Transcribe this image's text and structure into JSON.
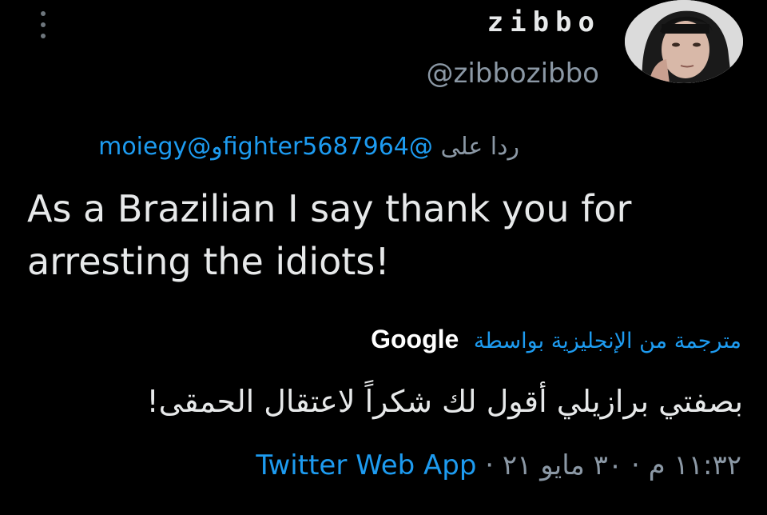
{
  "user": {
    "display_name": "zibbo",
    "handle": "@zibbozibbo"
  },
  "reply": {
    "prefix": "ردا على",
    "mention_1": "@fighter5687964",
    "conjunction": "و",
    "mention_2": "@moiegy"
  },
  "tweet": {
    "text": "As a Brazilian I say thank you for arresting the idiots!"
  },
  "translation": {
    "label": "مترجمة من الإنجليزية بواسطة",
    "provider": "Google",
    "text": "بصفتي برازيلي أقول لك شكراً لاعتقال الحمقى!"
  },
  "meta": {
    "time": "١١:٣٢ م",
    "separator": "·",
    "date": "٣٠ مايو ٢١",
    "source": "Twitter Web App"
  },
  "icons": {
    "more": "more-vertical-icon"
  },
  "colors": {
    "background": "#000000",
    "text": "#e7e9ea",
    "secondary": "#8b98a5",
    "link": "#1d9bf0"
  }
}
